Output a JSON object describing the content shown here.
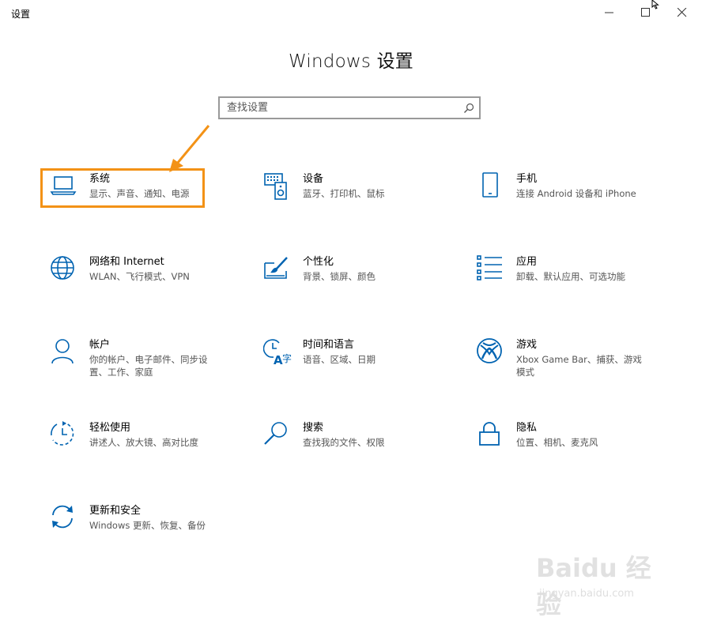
{
  "window": {
    "title": "设置",
    "controls": [
      "minimize",
      "maximize",
      "close"
    ]
  },
  "page": {
    "heading": "Windows 设置"
  },
  "search": {
    "placeholder": "查找设置"
  },
  "accent_color": "#0063b1",
  "highlight_color": "#f39216",
  "tiles": [
    {
      "id": "system",
      "icon": "laptop-icon",
      "title": "系统",
      "desc": "显示、声音、通知、电源",
      "highlighted": true
    },
    {
      "id": "devices",
      "icon": "keyboard-speaker-icon",
      "title": "设备",
      "desc": "蓝牙、打印机、鼠标"
    },
    {
      "id": "phone",
      "icon": "phone-icon",
      "title": "手机",
      "desc": "连接 Android 设备和 iPhone"
    },
    {
      "id": "network",
      "icon": "globe-icon",
      "title": "网络和 Internet",
      "desc": "WLAN、飞行模式、VPN"
    },
    {
      "id": "personalization",
      "icon": "paint-brush-icon",
      "title": "个性化",
      "desc": "背景、锁屏、颜色"
    },
    {
      "id": "apps",
      "icon": "apps-list-icon",
      "title": "应用",
      "desc": "卸载、默认应用、可选功能"
    },
    {
      "id": "accounts",
      "icon": "person-icon",
      "title": "帐户",
      "desc": "你的帐户、电子邮件、同步设\n置、工作、家庭"
    },
    {
      "id": "time-language",
      "icon": "time-language-icon",
      "title": "时间和语言",
      "desc": "语音、区域、日期"
    },
    {
      "id": "gaming",
      "icon": "xbox-icon",
      "title": "游戏",
      "desc": "Xbox Game Bar、捕获、游戏\n模式"
    },
    {
      "id": "ease-of-access",
      "icon": "ease-of-access-icon",
      "title": "轻松使用",
      "desc": "讲述人、放大镜、高对比度"
    },
    {
      "id": "search",
      "icon": "magnifier-icon",
      "title": "搜索",
      "desc": "查找我的文件、权限"
    },
    {
      "id": "privacy",
      "icon": "lock-icon",
      "title": "隐私",
      "desc": "位置、相机、麦克风"
    },
    {
      "id": "update-security",
      "icon": "sync-icon",
      "title": "更新和安全",
      "desc": "Windows 更新、恢复、备份"
    }
  ],
  "watermark": {
    "logo": "Baidu 经验",
    "url": "jingyan.baidu.com"
  }
}
